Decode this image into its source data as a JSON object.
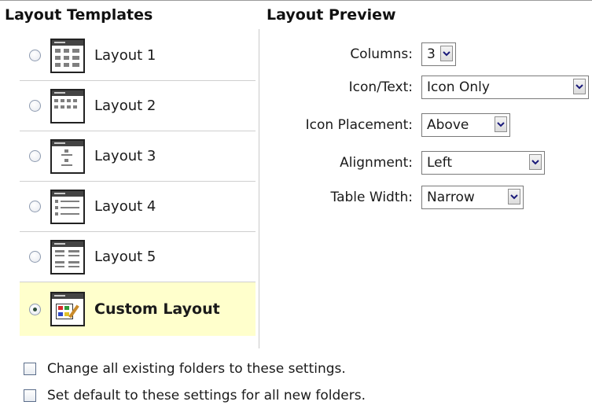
{
  "headings": {
    "templates": "Layout Templates",
    "preview": "Layout Preview"
  },
  "templates": [
    {
      "label": "Layout 1",
      "icon": "layout-1-thumbnail-icon",
      "selected": false
    },
    {
      "label": "Layout 2",
      "icon": "layout-2-thumbnail-icon",
      "selected": false
    },
    {
      "label": "Layout 3",
      "icon": "layout-3-thumbnail-icon",
      "selected": false
    },
    {
      "label": "Layout 4",
      "icon": "layout-4-thumbnail-icon",
      "selected": false
    },
    {
      "label": "Layout 5",
      "icon": "layout-5-thumbnail-icon",
      "selected": false
    },
    {
      "label": "Custom Layout",
      "icon": "custom-layout-palette-icon",
      "selected": true
    }
  ],
  "preview": {
    "columns": {
      "label": "Columns:",
      "value": "3"
    },
    "icon_text": {
      "label": "Icon/Text:",
      "value": "Icon Only"
    },
    "icon_placement": {
      "label": "Icon Placement:",
      "value": "Above"
    },
    "alignment": {
      "label": "Alignment:",
      "value": "Left"
    },
    "table_width": {
      "label": "Table Width:",
      "value": "Narrow"
    }
  },
  "options": {
    "change_existing": {
      "label": "Change all existing folders to these settings.",
      "checked": false
    },
    "set_default": {
      "label": "Set default to these settings for all new folders.",
      "checked": false
    }
  },
  "colors": {
    "selected_row_bg": "#ffffcc",
    "divider": "#cfcfcf"
  }
}
